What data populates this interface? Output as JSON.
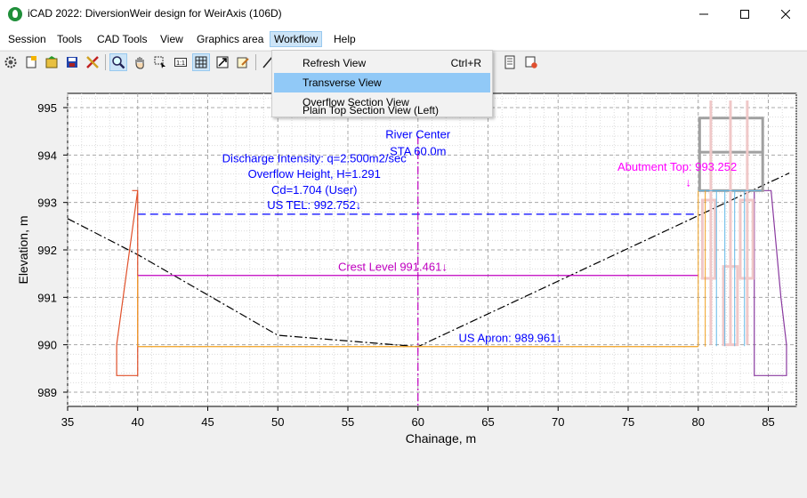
{
  "window": {
    "title": "iCAD 2022: DiversionWeir design for WeirAxis (106D)"
  },
  "menubar": {
    "items": [
      "Session",
      "Tools",
      "CAD Tools",
      "View",
      "Graphics area",
      "Workflow",
      "Help"
    ],
    "active": "Workflow"
  },
  "workflow_menu": {
    "items": [
      {
        "label": "Refresh View",
        "shortcut": "Ctrl+R"
      },
      {
        "label": "Transverse View",
        "shortcut": ""
      },
      {
        "label": "Overflow Section View",
        "shortcut": ""
      },
      {
        "label": "Plain Top Section View (Left)",
        "shortcut": ""
      }
    ],
    "highlighted": "Transverse View"
  },
  "toolbar": {
    "icons": [
      "gear-icon",
      "new-icon",
      "open-icon",
      "save-icon",
      "tools-icon",
      "zoom-icon",
      "pan-hand-icon",
      "select-window-icon",
      "fit-1to1-icon",
      "grid-icon",
      "zoom-extents-icon",
      "edit-icon",
      "measure-icon",
      "print-icon",
      "properties-icon"
    ]
  },
  "chart_data": {
    "type": "line",
    "xlabel": "Chainage, m",
    "ylabel": "Elevation, m",
    "xlim": [
      35,
      87
    ],
    "ylim": [
      988.7,
      995.3
    ],
    "xticks": [
      35,
      40,
      45,
      50,
      55,
      60,
      65,
      70,
      75,
      80,
      85
    ],
    "yticks": [
      989,
      990,
      991,
      992,
      993,
      994,
      995
    ],
    "grid": true,
    "series": [
      {
        "role": "ground-profile",
        "color": "#000000",
        "style": "dashdot",
        "x": [
          35,
          40,
          50,
          60,
          86.5
        ],
        "y": [
          992.66,
          991.9,
          990.2,
          989.96,
          993.62
        ]
      },
      {
        "role": "us-tel",
        "color": "#0000ff",
        "style": "dashed",
        "x": [
          40,
          80
        ],
        "y": [
          992.752,
          992.752
        ]
      },
      {
        "role": "crest-level",
        "color": "#c000c0",
        "style": "solid",
        "x": [
          40,
          80
        ],
        "y": [
          991.461,
          991.461
        ]
      },
      {
        "role": "us-apron",
        "color": "#f0a020",
        "style": "solid",
        "x": [
          40,
          80
        ],
        "y": [
          989.961,
          989.961
        ]
      },
      {
        "role": "left-abutment",
        "color": "#e0502a",
        "style": "solid",
        "x": [
          39.6,
          40,
          40,
          38.5,
          38.5,
          40,
          40
        ],
        "y": [
          993.25,
          993.25,
          989.35,
          989.35,
          990.0,
          993.25,
          993.25
        ]
      },
      {
        "role": "right-abutment",
        "color": "#8a3aa0",
        "style": "solid",
        "x": [
          84.4,
          85.2,
          85.9,
          86.3,
          86.3,
          84.0,
          84.0
        ],
        "y": [
          993.25,
          993.25,
          991.0,
          990.0,
          989.35,
          989.35,
          993.25
        ]
      },
      {
        "role": "river-center",
        "color": "#c000c0",
        "style": "dashdot",
        "x": [
          60,
          60
        ],
        "y": [
          994.4,
          988.7
        ]
      }
    ],
    "annotations": [
      {
        "text": "River Center",
        "x": 60,
        "y": 994.35,
        "color": "#0000ff"
      },
      {
        "text": "STA 60.0m",
        "x": 60,
        "y": 994.0,
        "color": "#0000ff"
      },
      {
        "text": "Discharge Intensity: q=2.500m2/sec",
        "x": 52.6,
        "y": 993.85,
        "color": "#0000ff"
      },
      {
        "text": "Overflow Height, H=1.291",
        "x": 52.6,
        "y": 993.52,
        "color": "#0000ff"
      },
      {
        "text": "Cd=1.704 (User)",
        "x": 52.6,
        "y": 993.18,
        "color": "#0000ff"
      },
      {
        "text": "US TEL: 992.752↓",
        "x": 52.6,
        "y": 992.86,
        "color": "#0000ff"
      },
      {
        "text": "Crest Level 991.461↓",
        "x": 58.2,
        "y": 991.56,
        "color": "#c000c0"
      },
      {
        "text": "US Apron: 989.961↓",
        "x": 66.6,
        "y": 990.06,
        "color": "#0000ff"
      },
      {
        "text": "Abutment Top: 993.252",
        "x": 78.5,
        "y": 993.67,
        "color": "#ff00ff"
      },
      {
        "text": "↓",
        "x": 79.3,
        "y": 993.34,
        "color": "#ff00ff"
      }
    ]
  }
}
